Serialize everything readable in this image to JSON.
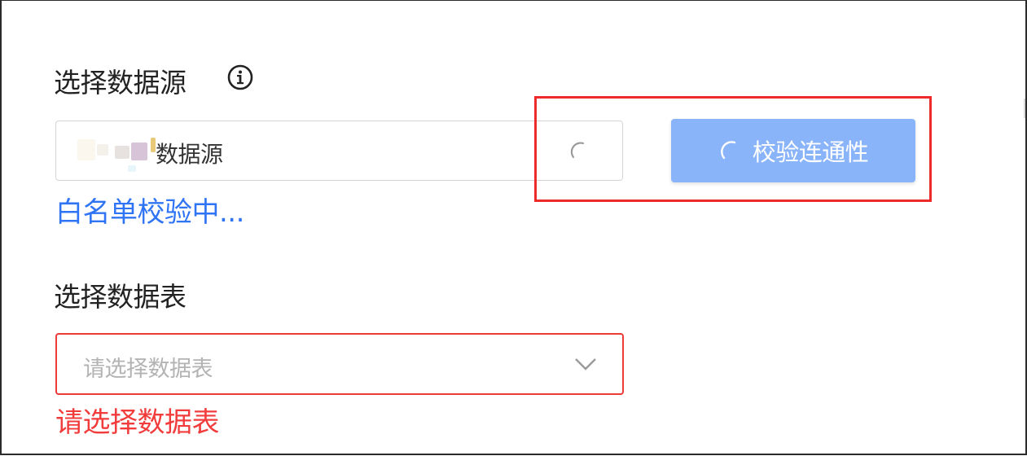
{
  "form": {
    "datasource": {
      "label": "选择数据源",
      "info_icon": "info-icon",
      "value_suffix": "数据源",
      "loading_icon": "loading-spinner-icon"
    },
    "verify_button": {
      "label": "校验连通性",
      "loading_icon": "loading-spinner-icon"
    },
    "status_text": "白名单校验中...",
    "table": {
      "label": "选择数据表",
      "placeholder": "请选择数据表",
      "dropdown_icon": "chevron-down-icon",
      "error_message": "请选择数据表"
    }
  },
  "colors": {
    "primary_disabled": "#8ab4fa",
    "status_blue": "#2f74f5",
    "error_red": "#f23c3c",
    "highlight_red": "#ee2b2b"
  }
}
